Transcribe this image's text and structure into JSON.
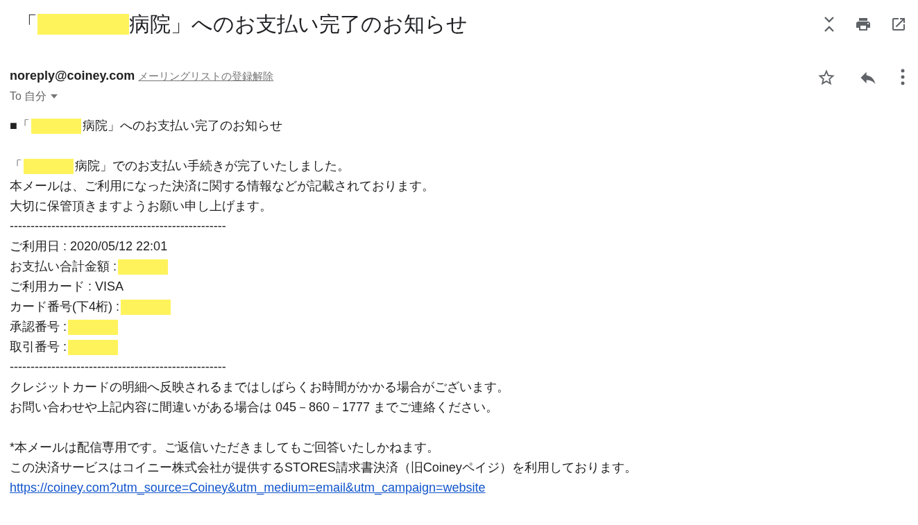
{
  "subject": [
    {
      "kind": "text",
      "text": "「"
    },
    {
      "kind": "redaction"
    },
    {
      "kind": "text",
      "text": "病院」へのお支払い完了のお知らせ"
    }
  ],
  "sender": {
    "address": "noreply@coiney.com",
    "unsubscribe": "メーリングリストの登録解除",
    "to": "To 自分"
  },
  "body": [
    {
      "kind": "text",
      "parts": [
        {
          "kind": "text",
          "text": "■「"
        },
        {
          "kind": "redaction"
        },
        {
          "kind": "text",
          "text": "病院」へのお支払い完了のお知らせ"
        }
      ]
    },
    {
      "kind": "blank"
    },
    {
      "kind": "text",
      "parts": [
        {
          "kind": "text",
          "text": "「"
        },
        {
          "kind": "redaction"
        },
        {
          "kind": "text",
          "text": "病院」でのお支払い手続きが完了いたしました。"
        }
      ]
    },
    {
      "kind": "text",
      "parts": [
        {
          "kind": "text",
          "text": "本メールは、ご利用になった決済に関する情報などが記載されております。"
        }
      ]
    },
    {
      "kind": "text",
      "parts": [
        {
          "kind": "text",
          "text": "大切に保管頂きますようお願い申し上げます。"
        }
      ]
    },
    {
      "kind": "text",
      "parts": [
        {
          "kind": "text",
          "text": "----------------------------------------------------"
        }
      ]
    },
    {
      "kind": "text",
      "parts": [
        {
          "kind": "text",
          "text": "ご利用日 : 2020/05/12 22:01"
        }
      ]
    },
    {
      "kind": "text",
      "parts": [
        {
          "kind": "text",
          "text": "お支払い合計金額 :"
        },
        {
          "kind": "redaction"
        }
      ]
    },
    {
      "kind": "text",
      "parts": [
        {
          "kind": "text",
          "text": "ご利用カード : VISA"
        }
      ]
    },
    {
      "kind": "text",
      "parts": [
        {
          "kind": "text",
          "text": "カード番号(下4桁) :"
        },
        {
          "kind": "redaction"
        }
      ]
    },
    {
      "kind": "text",
      "parts": [
        {
          "kind": "text",
          "text": "承認番号 :"
        },
        {
          "kind": "redaction"
        }
      ]
    },
    {
      "kind": "text",
      "parts": [
        {
          "kind": "text",
          "text": "取引番号 :"
        },
        {
          "kind": "redaction"
        }
      ]
    },
    {
      "kind": "text",
      "parts": [
        {
          "kind": "text",
          "text": "----------------------------------------------------"
        }
      ]
    },
    {
      "kind": "text",
      "parts": [
        {
          "kind": "text",
          "text": "クレジットカードの明細へ反映されるまではしばらくお時間がかかる場合がございます。"
        }
      ]
    },
    {
      "kind": "text",
      "parts": [
        {
          "kind": "text",
          "text": "お問い合わせや上記内容に間違いがある場合は 045－860－1777 までご連絡ください。"
        }
      ]
    },
    {
      "kind": "blank"
    },
    {
      "kind": "text",
      "parts": [
        {
          "kind": "text",
          "text": "*本メールは配信専用です。ご返信いただきましてもご回答いたしかねます。"
        }
      ]
    },
    {
      "kind": "text",
      "parts": [
        {
          "kind": "text",
          "text": "この決済サービスはコイニー株式会社が提供するSTORES請求書決済（旧Coineyペイジ）を利用しております。"
        }
      ]
    },
    {
      "kind": "link",
      "text": "https://coiney.com?utm_source=Coiney&utm_medium=email&utm_campaign=website"
    }
  ]
}
